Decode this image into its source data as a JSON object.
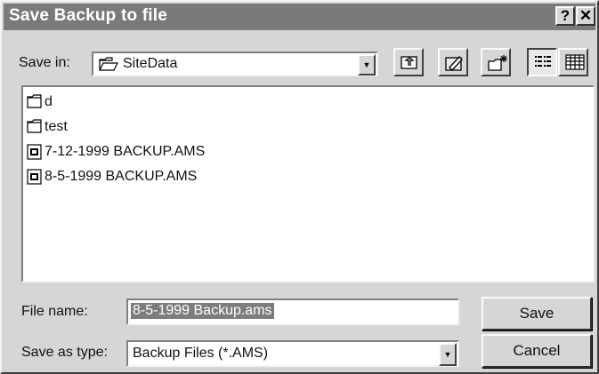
{
  "window": {
    "title": "Save Backup to file",
    "help_glyph": "?",
    "close_glyph": "✕"
  },
  "save_in": {
    "label": "Save in:",
    "value": "SiteData",
    "icon": "folder-open-icon"
  },
  "toolbar": {
    "buttons": [
      {
        "name": "up-one-level-button",
        "icon": "up-folder-icon"
      },
      {
        "name": "go-to-favorites-button",
        "icon": "favorites-icon"
      },
      {
        "name": "create-new-folder-button",
        "icon": "new-folder-icon"
      },
      {
        "name": "list-view-button",
        "icon": "list-view-icon"
      },
      {
        "name": "details-view-button",
        "icon": "details-view-icon"
      }
    ]
  },
  "files": [
    {
      "name": "d",
      "type": "folder"
    },
    {
      "name": "test",
      "type": "folder"
    },
    {
      "name": "7-12-1999 BACKUP.AMS",
      "type": "file"
    },
    {
      "name": "8-5-1999 BACKUP.AMS",
      "type": "file"
    }
  ],
  "file_name": {
    "label": "File name:",
    "value": "8-5-1999 Backup.ams"
  },
  "save_as_type": {
    "label": "Save as type:",
    "value": "Backup Files (*.AMS)"
  },
  "buttons": {
    "save": "Save",
    "cancel": "Cancel"
  }
}
